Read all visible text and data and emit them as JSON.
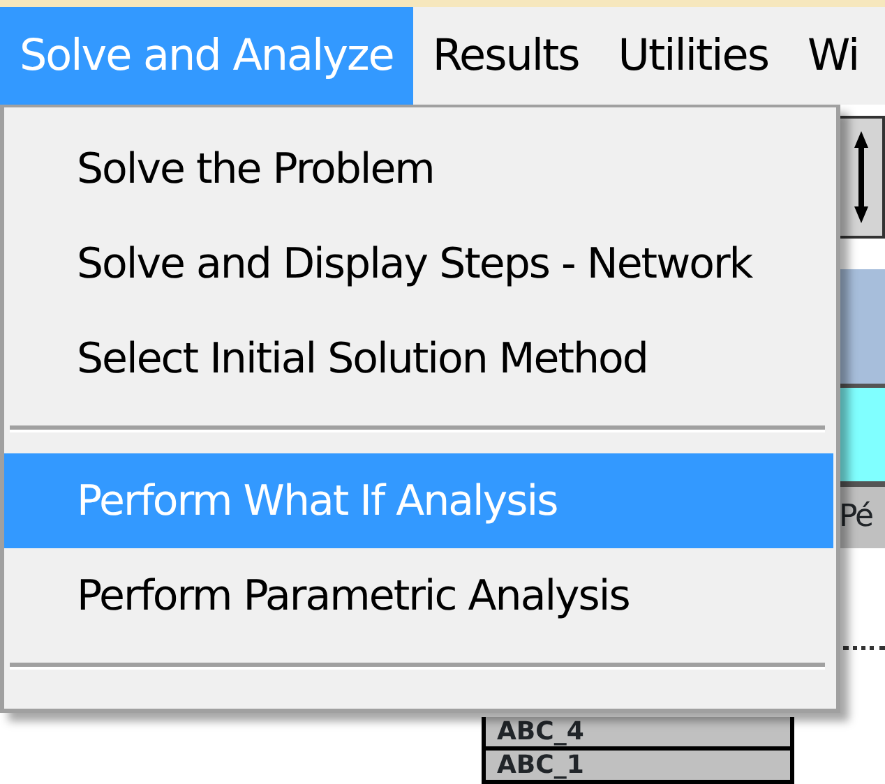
{
  "menubar": [
    {
      "label": "Solve and Analyze",
      "selected": true
    },
    {
      "label": "Results",
      "selected": false
    },
    {
      "label": "Utilities",
      "selected": false
    },
    {
      "label": "Wi",
      "selected": false
    }
  ],
  "menu": {
    "items": [
      {
        "kind": "item",
        "label": "Solve the Problem",
        "selected": false
      },
      {
        "kind": "item",
        "label": "Solve and Display Steps - Network",
        "selected": false
      },
      {
        "kind": "item",
        "label": "Select Initial Solution Method",
        "selected": false
      },
      {
        "kind": "separator"
      },
      {
        "kind": "item",
        "label": "Perform What If Analysis",
        "selected": true
      },
      {
        "kind": "item",
        "label": "Perform Parametric Analysis",
        "selected": false
      },
      {
        "kind": "separator"
      }
    ]
  },
  "table": {
    "column_header": "Pé",
    "cells": [
      "ABC_4",
      "ABC_1"
    ]
  }
}
